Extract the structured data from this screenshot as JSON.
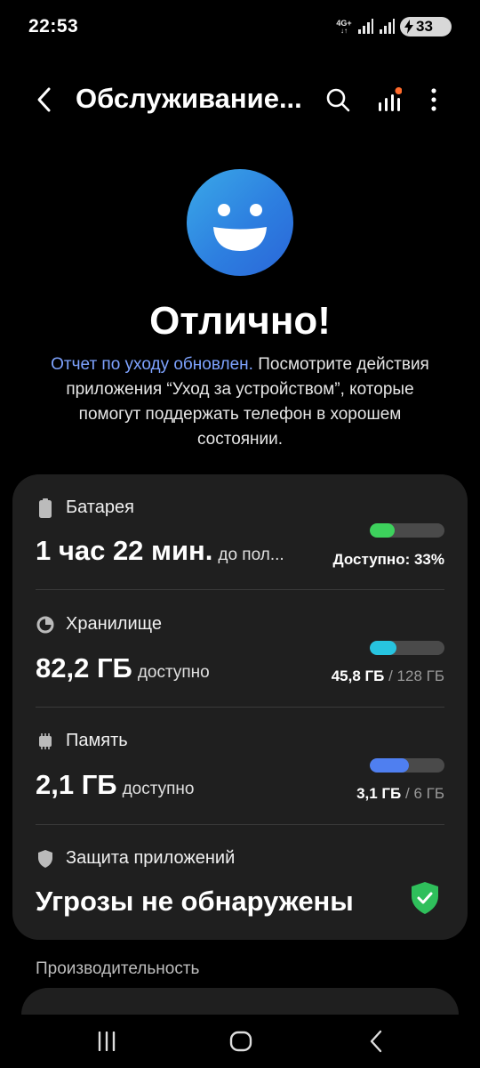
{
  "status_bar": {
    "time": "22:53",
    "network_label": "4G+",
    "battery_level": "33"
  },
  "app_bar": {
    "title": "Обслуживание...",
    "icons": [
      "back-icon",
      "search-icon",
      "signal-chart-icon",
      "more-icon"
    ],
    "notification_dot_color": "#ff6a2b"
  },
  "hero": {
    "title": "Отлично!",
    "link_text": "Отчет по уходу обновлен.",
    "description": " Посмотрите действия приложения “Уход за устройством”, которые помогут поддержать телефон в хорошем состоянии."
  },
  "sections": {
    "battery": {
      "label": "Батарея",
      "value": "1 час 22 мин.",
      "value_sub": "до пол...",
      "right_text": "Доступно: 33%",
      "level": 0.33,
      "color": "#3dd15c"
    },
    "storage": {
      "label": "Хранилище",
      "value": "82,2 ГБ",
      "value_sub": "доступно",
      "used": "45,8 ГБ",
      "separator": " / ",
      "total": "128 ГБ",
      "level": 0.36,
      "color": "#27c4e0"
    },
    "memory": {
      "label": "Память",
      "value": "2,1 ГБ",
      "value_sub": "доступно",
      "used": "3,1 ГБ",
      "separator": " / ",
      "total": "6 ГБ",
      "level": 0.52,
      "color": "#4f7ff0"
    },
    "app_protection": {
      "label": "Защита приложений",
      "value": "Угрозы не обнаружены",
      "status_color": "#2fbf5b"
    }
  },
  "performance_label": "Производительность",
  "nav": {
    "icons": [
      "recent-apps-icon",
      "home-icon",
      "back-nav-icon"
    ]
  }
}
